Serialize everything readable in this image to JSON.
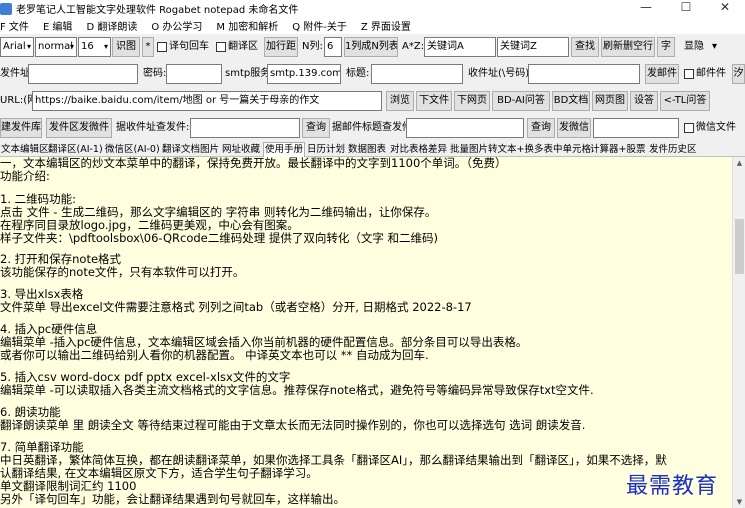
{
  "window": {
    "title": "老罗笔记人工智能文字处理软件 Rogabet notepad   未命名文件",
    "minimize": "—",
    "maximize": "☐",
    "close": "✕"
  },
  "menu": [
    "F 文件",
    "E 编辑",
    "D 翻译朗读",
    "O 办公学习",
    "M 加密和解析",
    "Q 附件-关于",
    "Z 界面设置"
  ],
  "toolbar1": {
    "font": "Arial",
    "weight": "normal",
    "size": "16",
    "recognize": "识图",
    "star": "*",
    "translate_return": "译句回车",
    "translate_area": "翻译区",
    "add_spacing": "加行距",
    "n_label": "N列:",
    "n_value": "6",
    "one_to_n": "1列成N列表",
    "az_label": "A*Z:",
    "keyword_a": "关键词A",
    "keyword_z": "关键词Z",
    "find": "查找",
    "refresh_blank": "刷新删空行",
    "char": "字",
    "display": "显隐",
    "display_arrow": "▾"
  },
  "toolbar2": {
    "sender_label": "发件址:",
    "password_label": "密码:",
    "smtp_label": "smtp服务",
    "smtp_value": "smtp.139.com",
    "subject_label": "标题:",
    "receiver_label": "收件址(\\号码):",
    "send_mail": "发邮件",
    "mail_file": "邮件件",
    "extra": "汐"
  },
  "toolbar3": {
    "url_label": "URL:(网)",
    "url_value": "https://baike.baidu.com/item/地图 or 号一篇关于母亲的作文",
    "browse": "浏览",
    "download": "下文件",
    "next_page": "下网页",
    "bd_ai": "BD-AI问答",
    "bd_doc": "BD文档",
    "webpage": "网页图",
    "ask": "设答",
    "tl_ask": "<-TL问答"
  },
  "toolbar4": {
    "create_lib": "建发件库",
    "send_wechat": "发件区发微件",
    "mail_addr_label": "据收件址查发件:",
    "query": "查询",
    "subject_query_label": "据邮件标题查发件:",
    "query2": "查询",
    "send_mail2": "发微信",
    "wechat_file": "微信文件"
  },
  "tabs": [
    "文本编辑区",
    "翻译区(AI-1)",
    "微信区(AI-0)",
    "翻译文档图片",
    "网址收藏",
    "使用手册",
    "日历计划",
    "数据图表",
    "对比表格差异",
    "批量图片转文本+换多表中单元格",
    "计算器+股票",
    "发件历史区"
  ],
  "editor_lines": [
    "一，文本编辑区的炒文本菜单中的翻译，保持免费开放。最长翻译中的文字到1100个单词。（免费）",
    "功能介绍:",
    "",
    "1. 二维码功能:",
    "点击 文件 - 生成二维码，那么文字编辑区的 字符串 则转化为二维码输出，让你保存。",
    "在程序同目录放logo.jpg，二维码更美观，中心会有图案。",
    "样子文件夹：\\pdftoolsbox\\06-QRcode二维码处理 提供了双向转化（文字 和二维码)",
    "",
    "2. 打开和保存note格式",
    "该功能保存的note文件，只有本软件可以打开。",
    "",
    "3. 导出xlsx表格",
    "文件菜单 导出excel文件需要注意格式 列列之间tab（或者空格）分开, 日期格式 2022-8-17",
    "",
    "4. 插入pc硬件信息",
    "编辑菜单 -插入pc硬件信息，文本编辑区域会插入你当前机器的硬件配置信息。部分条目可以导出表格。",
    "或者你可以输出二维码给别人看你的机器配置。  中译英文本也可以 ** 自动成为回车.",
    "",
    "5. 插入csv word-docx pdf pptx excel-xlsx文件的文字",
    "编辑菜单 -可以读取插入各类主流文档格式的文字信息。推荐保存note格式，避免符号等编码异常导致保存txt空文件.",
    "",
    "6. 朗读功能",
    "翻译朗读菜单 里 朗读全文 等待结束过程可能由于文章太长而无法同时操作别的，你也可以选择选句 选词 朗读发音.",
    "",
    "7. 简单翻译功能",
    "中日英翻译，繁体简体互换，都在朗读翻译菜单，如果你选择工具条「翻译区AI」，那么翻译结果输出到「翻译区」，如果不选择，默",
    "认翻译结果, 在文本编辑区原文下方，适合学生句子翻译学习。",
    "单文翻译限制词汇约 1100",
    "另外「译句回车」功能，会让翻译结果遇到句号就回车，这样输出。"
  ],
  "watermark": "最需教育"
}
